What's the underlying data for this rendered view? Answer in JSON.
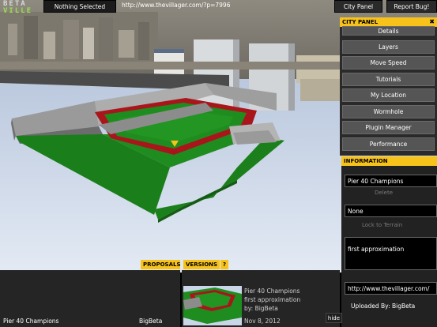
{
  "app": {
    "logo_line1": "BETA",
    "logo_line2": "VILLE"
  },
  "topbar": {
    "selection_status": "Nothing Selected",
    "url": "http://www.thevillager.com/?p=7996",
    "city_panel_button": "City Panel",
    "report_bug_button": "Report Bug!"
  },
  "city_panel": {
    "title": "CITY PANEL",
    "close": "✖",
    "items": [
      {
        "label": "Details"
      },
      {
        "label": "Layers"
      },
      {
        "label": "Move Speed"
      },
      {
        "label": "Tutorials"
      },
      {
        "label": "My Location"
      },
      {
        "label": "Wormhole"
      },
      {
        "label": "Plugin Manager"
      },
      {
        "label": "Performance"
      }
    ]
  },
  "information": {
    "title": "INFORMATION",
    "name_value": "Pier 40 Champions",
    "address_value": "None",
    "description": "first approximation",
    "url_value": "http://www.thevillager.com/",
    "uploaded_by": "Uploaded By: BigBeta",
    "hidden_button_1": "Delete",
    "hidden_button_2": "Lock to Terrain"
  },
  "proposals": {
    "tab": "PROPOSALS",
    "rows": [
      {
        "name": "Pier 40 Champions",
        "author": "BigBeta"
      }
    ]
  },
  "versions": {
    "tab": "VERSIONS",
    "help": "?",
    "item": {
      "name": "Pier 40 Champions",
      "description": "first approximation",
      "by": "by: BigBeta",
      "date": "Nov 8, 2012"
    }
  },
  "hide_button": "hide",
  "colors": {
    "accent": "#f7c21a",
    "panel": "#2a2a2a",
    "button": "#555555",
    "field_green": "#1d8a1d",
    "track_red": "#a8161c",
    "water": "#c9d6e8"
  }
}
